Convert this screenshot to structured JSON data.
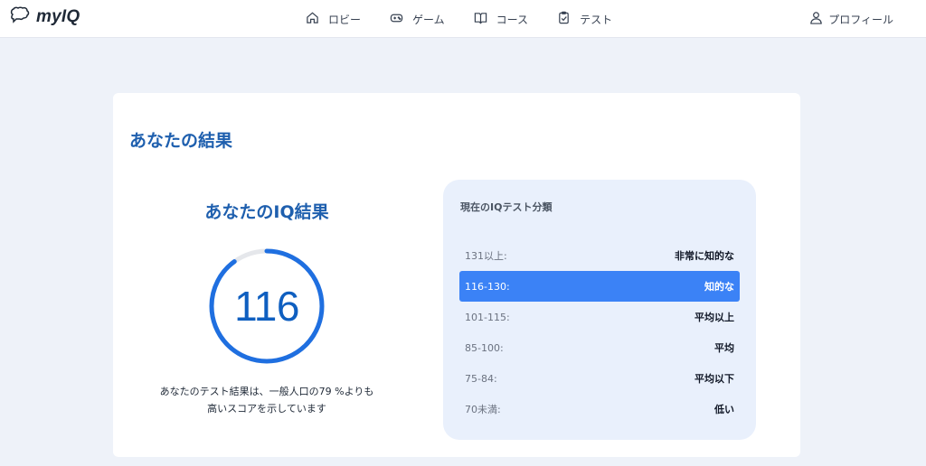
{
  "app": {
    "logo_text": "myIQ"
  },
  "nav": [
    {
      "label": "ロビー",
      "icon": "home-icon"
    },
    {
      "label": "ゲーム",
      "icon": "gamepad-icon"
    },
    {
      "label": "コース",
      "icon": "book-icon"
    },
    {
      "label": "テスト",
      "icon": "clipboard-icon"
    }
  ],
  "profile": {
    "label": "プロフィール",
    "icon": "user-icon"
  },
  "card": {
    "title": "あなたの結果"
  },
  "result": {
    "title": "あなたのIQ結果",
    "score": "116",
    "gauge_fraction": 0.9,
    "description_line1": "あなたのテスト結果は、一般人口の79 %よりも",
    "description_line2": "高いスコアを示しています"
  },
  "classification": {
    "title": "現在のIQテスト分類",
    "rows": [
      {
        "range": "131以上:",
        "label": "非常に知的な",
        "active": false
      },
      {
        "range": "116-130:",
        "label": "知的な",
        "active": true
      },
      {
        "range": "101-115:",
        "label": "平均以上",
        "active": false
      },
      {
        "range": "85-100:",
        "label": "平均",
        "active": false
      },
      {
        "range": "75-84:",
        "label": "平均以下",
        "active": false
      },
      {
        "range": "70未満:",
        "label": "低い",
        "active": false
      }
    ]
  },
  "colors": {
    "accent": "#1f6fe0",
    "title_blue": "#1e5fae",
    "active_row": "#3b82f6",
    "gauge_track": "#e5e7eb",
    "page_bg": "#eef2f9",
    "panel_bg": "#e9f0fc"
  }
}
